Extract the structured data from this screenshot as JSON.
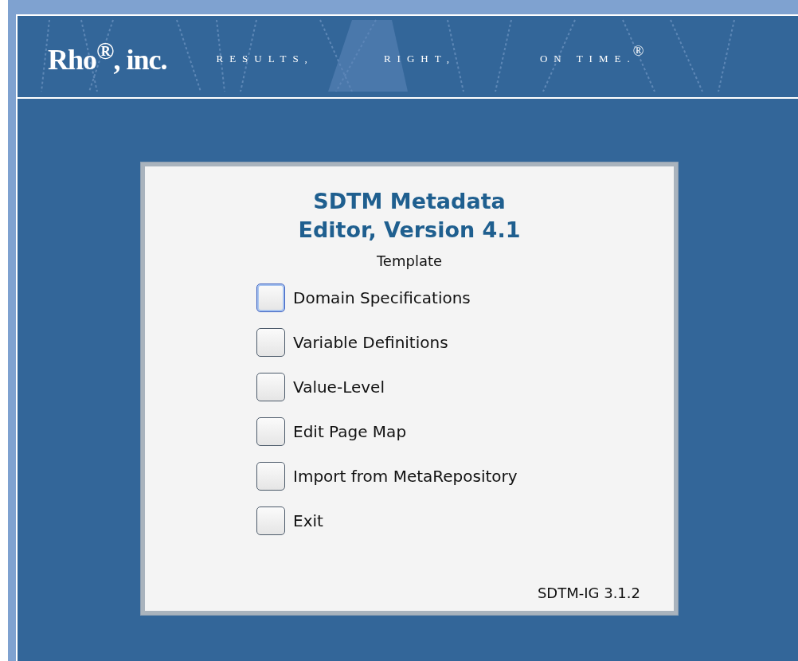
{
  "banner": {
    "logo": "Rho$^{®}$, inc.",
    "tagline": [
      "RESULTS,",
      "RIGHT,",
      "ON TIME."
    ],
    "trademark": "®"
  },
  "dialog": {
    "title": "SDTM Metadata Editor, Version 4.1",
    "subtitle": "Template",
    "buttons": [
      {
        "label": "Domain Specifications",
        "selected": true
      },
      {
        "label": "Variable Definitions",
        "selected": false
      },
      {
        "label": "Value-Level",
        "selected": false
      },
      {
        "label": "Edit Page Map",
        "selected": false
      },
      {
        "label": "Import from MetaRepository",
        "selected": false
      },
      {
        "label": "Exit",
        "selected": false
      }
    ],
    "footer": "SDTM-IG 3.1.2"
  }
}
